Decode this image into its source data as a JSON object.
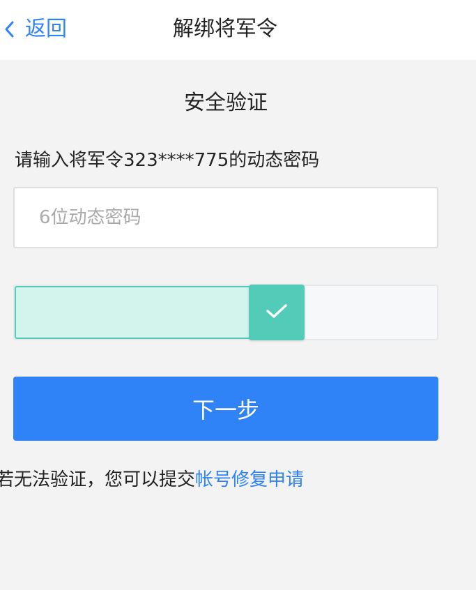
{
  "header": {
    "back_label": "返回",
    "title": "解绑将军令",
    "back_icon": "chevron-left-icon"
  },
  "main": {
    "section_title": "安全验证",
    "prompt": "请输入将军令323****775的动态密码",
    "code_input": {
      "placeholder": "6位动态密码",
      "value": ""
    },
    "slider": {
      "progress": 0.638,
      "status": "verified",
      "handle_icon": "check-icon"
    },
    "next_button_label": "下一步",
    "footer": {
      "prefix": "若无法验证，您可以提交",
      "link_label": "帐号修复申请"
    }
  },
  "colors": {
    "accent": "#2f83f7",
    "slider_success": "#52ccb8",
    "slider_fill": "#d2f4ec",
    "background": "#f3f3f3"
  }
}
